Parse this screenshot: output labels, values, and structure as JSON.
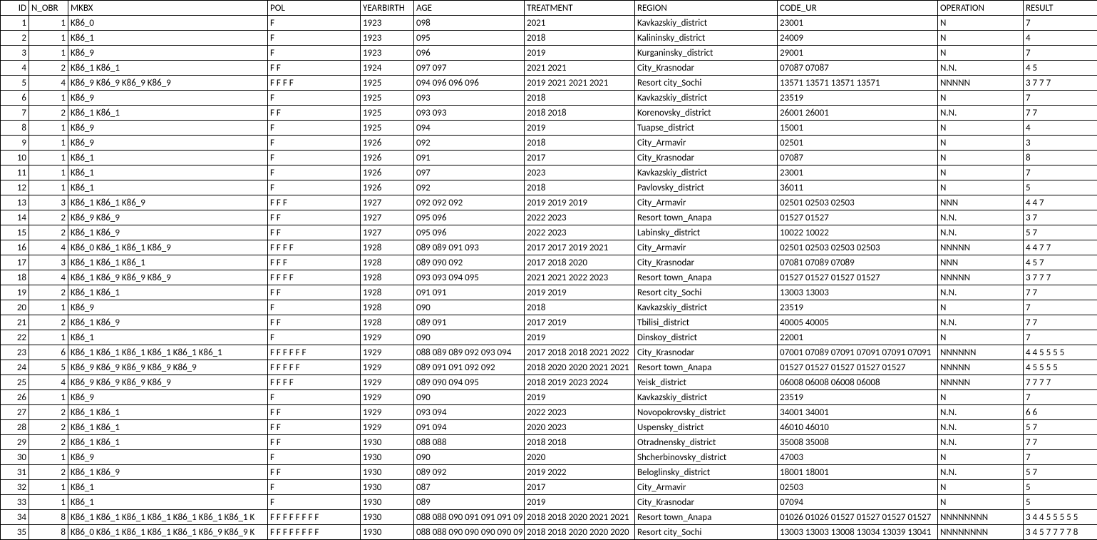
{
  "headers": [
    "ID",
    "N_OBR",
    "MKBX",
    "POL",
    "YEARBIRTH",
    "AGE",
    "TREATMENT",
    "REGION",
    "CODE_UR",
    "OPERATION",
    "RESULT"
  ],
  "rows": [
    {
      "id": "1",
      "n_obr": "1",
      "mkbx": "K86_0",
      "pol": "F",
      "year": "1923",
      "age": "098",
      "treat": "2021",
      "region": "Kavkazskiy_district",
      "code": "23001",
      "op": "N",
      "result": "7"
    },
    {
      "id": "2",
      "n_obr": "1",
      "mkbx": "K86_1",
      "pol": "F",
      "year": "1923",
      "age": "095",
      "treat": "2018",
      "region": "Kalininsky_district",
      "code": "24009",
      "op": "N",
      "result": "4"
    },
    {
      "id": "3",
      "n_obr": "1",
      "mkbx": "K86_9",
      "pol": "F",
      "year": "1923",
      "age": "096",
      "treat": "2019",
      "region": "Kurganinsky_district",
      "code": "29001",
      "op": "N",
      "result": "7"
    },
    {
      "id": "4",
      "n_obr": "2",
      "mkbx": "K86_1 K86_1",
      "pol": "F F",
      "year": "1924",
      "age": "097 097",
      "treat": "2021 2021",
      "region": "City_Krasnodar",
      "code": "07087 07087",
      "op": "N.N.",
      "result": "4 5"
    },
    {
      "id": "5",
      "n_obr": "4",
      "mkbx": "K86_9 K86_9 K86_9 K86_9",
      "pol": "F F F F",
      "year": "1925",
      "age": "094 096 096 096",
      "treat": "2019 2021 2021 2021",
      "region": "Resort city_Sochi",
      "code": "13571 13571 13571 13571",
      "op": "NNNNN",
      "result": "3 7 7 7"
    },
    {
      "id": "6",
      "n_obr": "1",
      "mkbx": "K86_9",
      "pol": "F",
      "year": "1925",
      "age": "093",
      "treat": "2018",
      "region": "Kavkazskiy_district",
      "code": "23519",
      "op": "N",
      "result": "7"
    },
    {
      "id": "7",
      "n_obr": "2",
      "mkbx": "K86_1 K86_1",
      "pol": "F F",
      "year": "1925",
      "age": "093 093",
      "treat": "2018 2018",
      "region": "Korenovsky_district",
      "code": "26001 26001",
      "op": "N.N.",
      "result": "7 7"
    },
    {
      "id": "8",
      "n_obr": "1",
      "mkbx": "K86_9",
      "pol": "F",
      "year": "1925",
      "age": "094",
      "treat": "2019",
      "region": "Tuapse_district",
      "code": "15001",
      "op": "N",
      "result": "4"
    },
    {
      "id": "9",
      "n_obr": "1",
      "mkbx": "K86_9",
      "pol": "F",
      "year": "1926",
      "age": "092",
      "treat": "2018",
      "region": "City_Armavir",
      "code": "02501",
      "op": "N",
      "result": "3"
    },
    {
      "id": "10",
      "n_obr": "1",
      "mkbx": "K86_1",
      "pol": "F",
      "year": "1926",
      "age": "091",
      "treat": "2017",
      "region": "City_Krasnodar",
      "code": "07087",
      "op": "N",
      "result": "8"
    },
    {
      "id": "11",
      "n_obr": "1",
      "mkbx": "K86_1",
      "pol": "F",
      "year": "1926",
      "age": "097",
      "treat": "2023",
      "region": "Kavkazskiy_district",
      "code": "23001",
      "op": "N",
      "result": "7"
    },
    {
      "id": "12",
      "n_obr": "1",
      "mkbx": "K86_1",
      "pol": "F",
      "year": "1926",
      "age": "092",
      "treat": "2018",
      "region": "Pavlovsky_district",
      "code": "36011",
      "op": "N",
      "result": "5"
    },
    {
      "id": "13",
      "n_obr": "3",
      "mkbx": "K86_1 K86_1 K86_9",
      "pol": "F F F",
      "year": "1927",
      "age": "092 092 092",
      "treat": "2019 2019 2019",
      "region": "City_Armavir",
      "code": "02501 02503 02503",
      "op": "NNN",
      "result": "4 4 7"
    },
    {
      "id": "14",
      "n_obr": "2",
      "mkbx": "K86_9 K86_9",
      "pol": "F F",
      "year": "1927",
      "age": "095 096",
      "treat": "2022 2023",
      "region": "Resort town_Anapa",
      "code": "01527 01527",
      "op": "N.N.",
      "result": "3 7"
    },
    {
      "id": "15",
      "n_obr": "2",
      "mkbx": "K86_1 K86_9",
      "pol": "F F",
      "year": "1927",
      "age": "095 096",
      "treat": "2022 2023",
      "region": "Labinsky_district",
      "code": "10022 10022",
      "op": "N.N.",
      "result": "5 7"
    },
    {
      "id": "16",
      "n_obr": "4",
      "mkbx": "K86_0 K86_1 K86_1 K86_9",
      "pol": "F F F F",
      "year": "1928",
      "age": "089 089 091 093",
      "treat": "2017 2017 2019 2021",
      "region": "City_Armavir",
      "code": "02501 02503 02503 02503",
      "op": "NNNNN",
      "result": "4 4 7 7"
    },
    {
      "id": "17",
      "n_obr": "3",
      "mkbx": "K86_1 K86_1 K86_1",
      "pol": "F F F",
      "year": "1928",
      "age": "089 090 092",
      "treat": "2017 2018 2020",
      "region": "City_Krasnodar",
      "code": "07081 07089 07089",
      "op": "NNN",
      "result": "4 5 7"
    },
    {
      "id": "18",
      "n_obr": "4",
      "mkbx": "K86_1 K86_9 K86_9 K86_9",
      "pol": "F F F F",
      "year": "1928",
      "age": "093 093 094 095",
      "treat": "2021 2021 2022 2023",
      "region": "Resort town_Anapa",
      "code": "01527 01527 01527 01527",
      "op": "NNNNN",
      "result": "3 7 7 7"
    },
    {
      "id": "19",
      "n_obr": "2",
      "mkbx": "K86_1 K86_1",
      "pol": "F F",
      "year": "1928",
      "age": "091 091",
      "treat": "2019 2019",
      "region": "Resort city_Sochi",
      "code": "13003 13003",
      "op": "N.N.",
      "result": "7 7"
    },
    {
      "id": "20",
      "n_obr": "1",
      "mkbx": "K86_9",
      "pol": "F",
      "year": "1928",
      "age": "090",
      "treat": "2018",
      "region": "Kavkazskiy_district",
      "code": "23519",
      "op": "N",
      "result": "7"
    },
    {
      "id": "21",
      "n_obr": "2",
      "mkbx": "K86_1 K86_9",
      "pol": "F F",
      "year": "1928",
      "age": "089 091",
      "treat": "2017 2019",
      "region": "Tbilisi_district",
      "code": "40005 40005",
      "op": "N.N.",
      "result": "7 7"
    },
    {
      "id": "22",
      "n_obr": "1",
      "mkbx": "K86_1",
      "pol": "F",
      "year": "1929",
      "age": "090",
      "treat": "2019",
      "region": "Dinskoy_district",
      "code": "22001",
      "op": "N",
      "result": "7"
    },
    {
      "id": "23",
      "n_obr": "6",
      "mkbx": "K86_1 K86_1 K86_1 K86_1 K86_1 K86_1",
      "pol": "F F F F F F",
      "year": "1929",
      "age": "088 089 089 092 093 094",
      "treat": "2017 2018 2018 2021 2022",
      "region": "City_Krasnodar",
      "code": "07001 07089 07091 07091 07091 07091",
      "op": "NNNNNN",
      "result": "4 4 5 5 5 5"
    },
    {
      "id": "24",
      "n_obr": "5",
      "mkbx": "K86_9 K86_9 K86_9 K86_9 K86_9",
      "pol": "F F F F F",
      "year": "1929",
      "age": "089 091 091 092 092",
      "treat": "2018 2020 2020 2021 2021",
      "region": "Resort town_Anapa",
      "code": "01527 01527 01527 01527 01527",
      "op": "NNNNN",
      "result": "4 5 5 5 5"
    },
    {
      "id": "25",
      "n_obr": "4",
      "mkbx": "K86_9 K86_9 K86_9 K86_9",
      "pol": "F F F F",
      "year": "1929",
      "age": "089 090 094 095",
      "treat": "2018 2019 2023 2024",
      "region": "Yeisk_district",
      "code": "06008 06008 06008 06008",
      "op": "NNNNN",
      "result": "7 7 7 7"
    },
    {
      "id": "26",
      "n_obr": "1",
      "mkbx": "K86_9",
      "pol": "F",
      "year": "1929",
      "age": "090",
      "treat": "2019",
      "region": "Kavkazskiy_district",
      "code": "23519",
      "op": "N",
      "result": "7"
    },
    {
      "id": "27",
      "n_obr": "2",
      "mkbx": "K86_1 K86_1",
      "pol": "F F",
      "year": "1929",
      "age": "093 094",
      "treat": "2022 2023",
      "region": "Novopokrovsky_district",
      "code": "34001 34001",
      "op": "N.N.",
      "result": "6 6"
    },
    {
      "id": "28",
      "n_obr": "2",
      "mkbx": "K86_1 K86_1",
      "pol": "F F",
      "year": "1929",
      "age": "091 094",
      "treat": "2020 2023",
      "region": "Uspensky_district",
      "code": "46010 46010",
      "op": "N.N.",
      "result": "5 7"
    },
    {
      "id": "29",
      "n_obr": "2",
      "mkbx": "K86_1 K86_1",
      "pol": "F F",
      "year": "1930",
      "age": "088 088",
      "treat": "2018 2018",
      "region": "Otradnensky_district",
      "code": "35008 35008",
      "op": "N.N.",
      "result": "7 7"
    },
    {
      "id": "30",
      "n_obr": "1",
      "mkbx": "K86_9",
      "pol": "F",
      "year": "1930",
      "age": "090",
      "treat": "2020",
      "region": "Shcherbinovsky_district",
      "code": "47003",
      "op": "N",
      "result": "7"
    },
    {
      "id": "31",
      "n_obr": "2",
      "mkbx": "K86_1 K86_9",
      "pol": "F F",
      "year": "1930",
      "age": "089 092",
      "treat": "2019 2022",
      "region": "Beloglinsky_district",
      "code": "18001 18001",
      "op": "N.N.",
      "result": "5 7"
    },
    {
      "id": "32",
      "n_obr": "1",
      "mkbx": "K86_1",
      "pol": "F",
      "year": "1930",
      "age": "087",
      "treat": "2017",
      "region": "City_Armavir",
      "code": "02503",
      "op": "N",
      "result": "5"
    },
    {
      "id": "33",
      "n_obr": "1",
      "mkbx": "K86_1",
      "pol": "F",
      "year": "1930",
      "age": "089",
      "treat": "2019",
      "region": "City_Krasnodar",
      "code": "07094",
      "op": "N",
      "result": "5"
    },
    {
      "id": "34",
      "n_obr": "8",
      "mkbx": "K86_1 K86_1 K86_1 K86_1 K86_1 K86_1 K86_1 K",
      "pol": "F F F F F F F F",
      "year": "1930",
      "age": "088 088 090 091 091 091 09",
      "treat": "2018 2018 2020 2021 2021",
      "region": "Resort town_Anapa",
      "code": "01026 01026 01527 01527 01527 01527",
      "op": "NNNNNNNN",
      "result": "3 4 4 5 5 5 5 5"
    },
    {
      "id": "35",
      "n_obr": "8",
      "mkbx": "K86_0 K86_1 K86_1 K86_1 K86_1 K86_9 K86_9 K",
      "pol": "F F F F F F F F",
      "year": "1930",
      "age": "088 088 090 090 090 090 09",
      "treat": "2018 2018 2020 2020 2020",
      "region": "Resort city_Sochi",
      "code": "13003 13003 13008 13034 13039 13041",
      "op": "NNNNNNNN",
      "result": "3 4 5 7 7 7 7 8"
    }
  ]
}
